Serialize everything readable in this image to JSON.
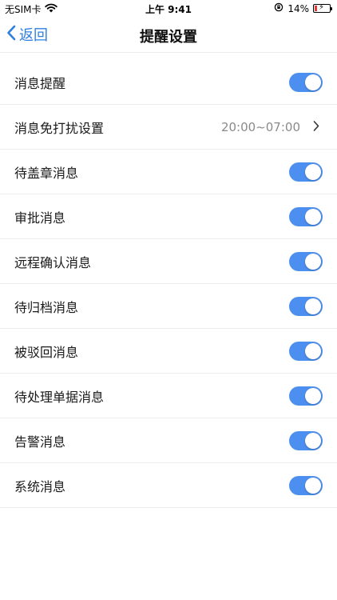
{
  "status_bar": {
    "carrier": "无SIM卡",
    "time": "上午 9:41",
    "battery_percent": "14%",
    "battery_level": 0.14,
    "icons": [
      "wifi-icon",
      "orientation-lock-icon",
      "battery-icon",
      "charging-bolt-icon"
    ]
  },
  "nav": {
    "back_label": "返回",
    "title": "提醒设置",
    "accent_color": "#2f7fe2"
  },
  "settings": {
    "toggle_on_color": "#4d8ff0",
    "items": [
      {
        "label": "消息提醒",
        "type": "toggle",
        "on": true
      },
      {
        "label": "消息免打扰设置",
        "type": "link",
        "value": "20:00~07:00"
      },
      {
        "label": "待盖章消息",
        "type": "toggle",
        "on": true
      },
      {
        "label": "审批消息",
        "type": "toggle",
        "on": true
      },
      {
        "label": "远程确认消息",
        "type": "toggle",
        "on": true
      },
      {
        "label": "待归档消息",
        "type": "toggle",
        "on": true
      },
      {
        "label": "被驳回消息",
        "type": "toggle",
        "on": true
      },
      {
        "label": "待处理单据消息",
        "type": "toggle",
        "on": true
      },
      {
        "label": "告警消息",
        "type": "toggle",
        "on": true
      },
      {
        "label": "系统消息",
        "type": "toggle",
        "on": true
      }
    ]
  }
}
